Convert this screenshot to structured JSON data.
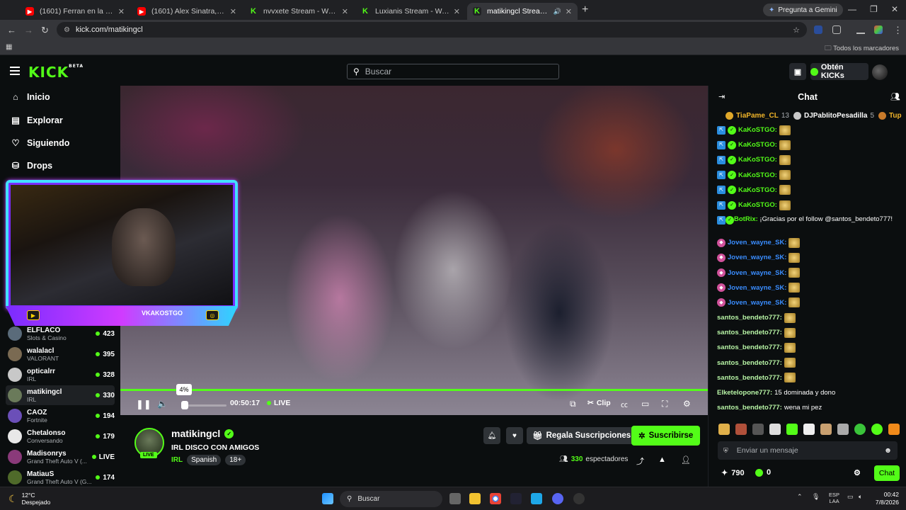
{
  "browser": {
    "tabs": [
      {
        "title": "(1601) Ferran en la lista - YouTu",
        "icon": "youtube-icon"
      },
      {
        "title": "(1601) Alex Sinatra, Nickoog Cl",
        "icon": "youtube-icon"
      },
      {
        "title": "nvvxete Stream - Watch Live on",
        "icon": "kick-icon"
      },
      {
        "title": "Luxianis Stream - Watch Live on",
        "icon": "kick-icon"
      },
      {
        "title": "matikingcl Stream - Watch",
        "icon": "kick-icon",
        "active": true
      }
    ],
    "gemini_label": "Pregunta a Gemini",
    "url": "kick.com/matikingcl",
    "bookmarks_label": "Todos los marcadores"
  },
  "header": {
    "logo": "KICK",
    "logo_badge": "BETA",
    "search_placeholder": "Buscar",
    "get_kicks_label": "Obtén KICKs"
  },
  "sidebar": {
    "nav": [
      {
        "label": "Inicio",
        "icon": "home-icon"
      },
      {
        "label": "Explorar",
        "icon": "compass-icon"
      },
      {
        "label": "Siguiendo",
        "icon": "heart-icon"
      },
      {
        "label": "Drops",
        "icon": "drops-icon"
      }
    ],
    "channels": [
      {
        "name": "ELFLACO",
        "category": "Slots & Casino",
        "viewers": "423"
      },
      {
        "name": "walalacl",
        "category": "VALORANT",
        "viewers": "395"
      },
      {
        "name": "opticalrr",
        "category": "IRL",
        "viewers": "328"
      },
      {
        "name": "matikingcl",
        "category": "IRL",
        "viewers": "330",
        "selected": true
      },
      {
        "name": "CAOZ",
        "category": "Fortnite",
        "viewers": "194"
      },
      {
        "name": "Chetalonso",
        "category": "Conversando",
        "viewers": "179"
      },
      {
        "name": "Madisonrys",
        "category": "Grand Theft Auto V (...",
        "viewers": "LIVE"
      },
      {
        "name": "MatiauS",
        "category": "Grand Theft Auto V (G...",
        "viewers": "174"
      }
    ]
  },
  "overlay": {
    "webcam_label": "VKAKOSTGO"
  },
  "player": {
    "volume_percent": 4,
    "volume_tooltip": "4%",
    "time": "00:50:17",
    "live_label": "LIVE",
    "clip_label": "Clip"
  },
  "stream": {
    "streamer": "matikingcl",
    "live_badge": "LIVE",
    "title": "IRL DISCO CON AMIGOS",
    "category": "IRL",
    "language": "Spanish",
    "rating": "18+",
    "gift_label": "Regala Suscripciones",
    "subscribe_label": "Suscribirse",
    "viewers": "330",
    "viewers_label": "espectadores"
  },
  "chat": {
    "title": "Chat",
    "gifters": [
      {
        "name": "TiaPame_CL",
        "count": "13"
      },
      {
        "name": "DJPabIitoPesadilla",
        "count": "5"
      },
      {
        "name": "Tup",
        "count": ""
      }
    ],
    "messages": [
      {
        "user": "KaKoSTGO:",
        "text": "",
        "style": "green",
        "badges": [
          "blue",
          "green"
        ],
        "emote": true
      },
      {
        "user": "KaKoSTGO:",
        "text": "",
        "style": "green",
        "badges": [
          "blue",
          "green"
        ],
        "emote": true
      },
      {
        "user": "KaKoSTGO:",
        "text": "",
        "style": "green",
        "badges": [
          "blue",
          "green"
        ],
        "emote": true
      },
      {
        "user": "KaKoSTGO:",
        "text": "",
        "style": "green",
        "badges": [
          "blue",
          "green"
        ],
        "emote": true
      },
      {
        "user": "KaKoSTGO:",
        "text": "",
        "style": "green",
        "badges": [
          "blue",
          "green"
        ],
        "emote": true
      },
      {
        "user": "KaKoSTGO:",
        "text": "",
        "style": "green",
        "badges": [
          "blue",
          "green"
        ],
        "emote": true
      },
      {
        "user": "BotRix:",
        "text": " ¡Gracias por el follow @santos_bendeto777!",
        "style": "green",
        "badges": [
          "blue",
          "green"
        ],
        "emote": false,
        "tall": true
      },
      {
        "user": "Joven_wayne_SK:",
        "text": "",
        "style": "blue",
        "badges": [
          "pink"
        ],
        "emote": true
      },
      {
        "user": "Joven_wayne_SK:",
        "text": "",
        "style": "blue",
        "badges": [
          "pink"
        ],
        "emote": true
      },
      {
        "user": "Joven_wayne_SK:",
        "text": "",
        "style": "blue",
        "badges": [
          "pink"
        ],
        "emote": true
      },
      {
        "user": "Joven_wayne_SK:",
        "text": "",
        "style": "blue",
        "badges": [
          "pink"
        ],
        "emote": true
      },
      {
        "user": "Joven_wayne_SK:",
        "text": "",
        "style": "blue",
        "badges": [
          "pink"
        ],
        "emote": true
      },
      {
        "user": "santos_bendeto777:",
        "text": "",
        "style": "pale",
        "badges": [],
        "emote": true
      },
      {
        "user": "santos_bendeto777:",
        "text": "",
        "style": "pale",
        "badges": [],
        "emote": true
      },
      {
        "user": "santos_bendeto777:",
        "text": "",
        "style": "pale",
        "badges": [],
        "emote": true
      },
      {
        "user": "santos_bendeto777:",
        "text": "",
        "style": "pale",
        "badges": [],
        "emote": true
      },
      {
        "user": "santos_bendeto777:",
        "text": "",
        "style": "pale",
        "badges": [],
        "emote": true
      },
      {
        "user": "Elketelopone777:",
        "text": " 15 dominada y dono",
        "style": "pale",
        "badges": [],
        "emote": false
      },
      {
        "user": "santos_bendeto777:",
        "text": " wena mi pez",
        "style": "pale",
        "badges": [],
        "emote": false
      }
    ],
    "input_placeholder": "Enviar un mensaje",
    "points": "790",
    "kicks": "0",
    "send_label": "Chat"
  },
  "taskbar": {
    "temperature": "12°C",
    "weather": "Despejado",
    "search_label": "Buscar",
    "lang_top": "ESP",
    "lang_bottom": "LAA",
    "time": "00:42",
    "date": "7/8/2026"
  },
  "colors": {
    "accent": "#53fc18",
    "background": "#0b0e0f"
  }
}
